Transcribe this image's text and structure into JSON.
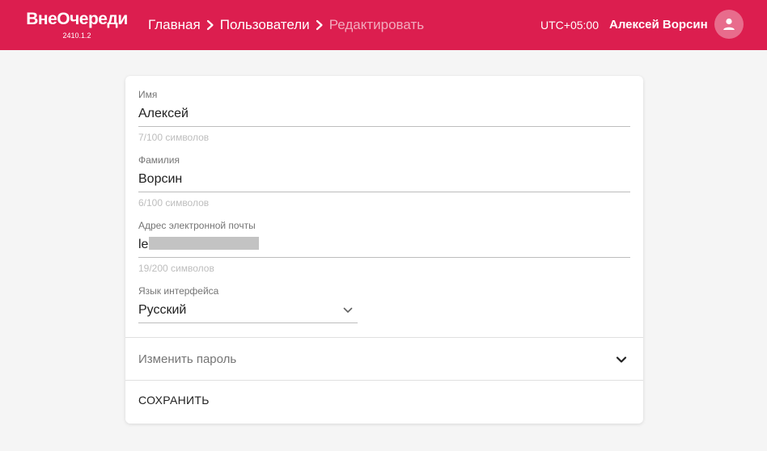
{
  "header": {
    "logo": "ВнеОчереди",
    "version": "2410.1.2",
    "breadcrumb": [
      "Главная",
      "Пользователи",
      "Редактировать"
    ],
    "timezone": "UTC+05:00",
    "user_name": "Алексей Ворсин",
    "avatar_icon": "user-icon",
    "background_color": "#dc1e4f"
  },
  "form": {
    "first_name": {
      "label": "Имя",
      "value": "Алексей",
      "counter": "7/100 символов"
    },
    "last_name": {
      "label": "Фамилия",
      "value": "Ворсин",
      "counter": "6/100 символов"
    },
    "email": {
      "label": "Адрес электронной почты",
      "value": "le",
      "counter": "19/200 символов"
    },
    "language": {
      "label": "Язык интерфейса",
      "value": "Русский",
      "icon": "chevron-down-icon"
    },
    "change_password": {
      "label": "Изменить пароль",
      "icon": "chevron-down-icon"
    },
    "save_label": "СОХРАНИТЬ"
  }
}
